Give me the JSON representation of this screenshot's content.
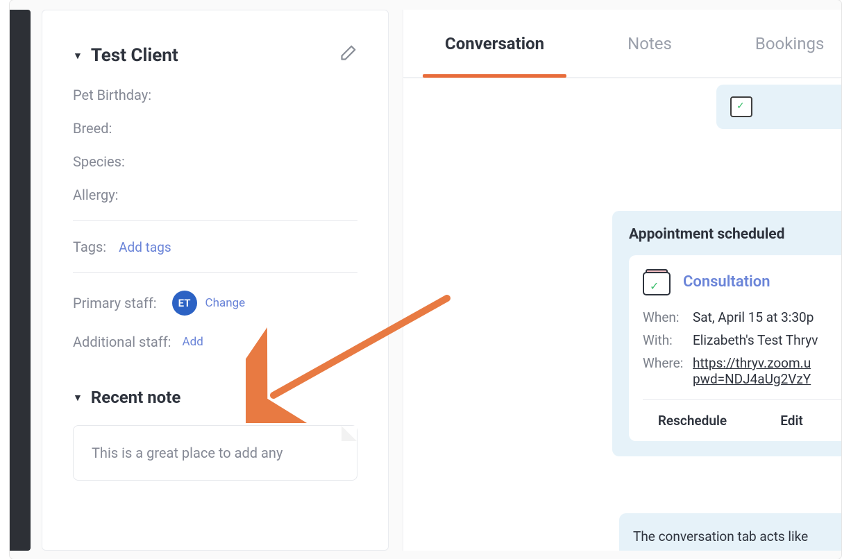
{
  "client": {
    "name": "Test Client",
    "fields": [
      {
        "label": "Pet Birthday:"
      },
      {
        "label": "Breed:"
      },
      {
        "label": "Species:"
      },
      {
        "label": "Allergy:"
      }
    ],
    "tags_label": "Tags:",
    "add_tags_label": "Add tags",
    "primary_staff_label": "Primary staff:",
    "primary_staff_initials": "ET",
    "change_label": "Change",
    "additional_staff_label": "Additional staff:",
    "add_label": "Add"
  },
  "recent_note": {
    "heading": "Recent note",
    "body": "This is a great place to add any"
  },
  "tabs": {
    "conversation": "Conversation",
    "notes": "Notes",
    "bookings": "Bookings"
  },
  "appointment": {
    "title": "Appointment scheduled",
    "service": "Consultation",
    "when_label": "When:",
    "when_value": "Sat, April 15 at 3:30p",
    "with_label": "With:",
    "with_value": "Elizabeth's Test Thryv",
    "where_label": "Where:",
    "where_url_line1": "https://thryv.zoom.u",
    "where_url_line2": "pwd=NDJ4aUg2VzY",
    "reschedule": "Reschedule",
    "edit": "Edit"
  },
  "tip": "The conversation tab acts like"
}
